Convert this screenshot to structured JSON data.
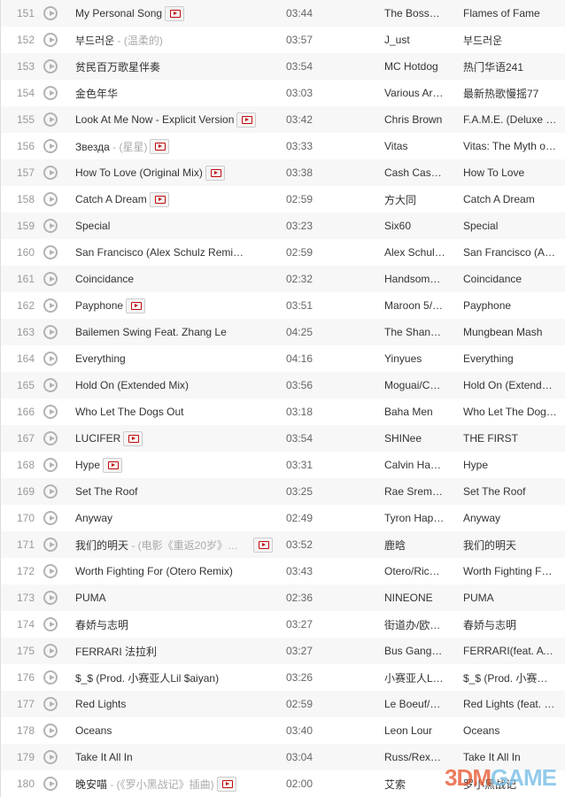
{
  "songs": [
    {
      "num": "151",
      "title": "My Personal Song",
      "sub": "",
      "mv": true,
      "duration": "03:44",
      "artist": "The Boss…",
      "album": "Flames of Fame"
    },
    {
      "num": "152",
      "title": "부드러운",
      "sub": " - (温柔的)",
      "mv": false,
      "duration": "03:57",
      "artist": "J_ust",
      "album": "부드러운"
    },
    {
      "num": "153",
      "title": "贫民百万歌星伴奏",
      "sub": "",
      "mv": false,
      "duration": "03:54",
      "artist": "MC Hotdog",
      "album": "热门华语241"
    },
    {
      "num": "154",
      "title": "金色年华",
      "sub": "",
      "mv": false,
      "duration": "03:03",
      "artist": "Various Ar…",
      "album": "最新热歌慢摇77"
    },
    {
      "num": "155",
      "title": "Look At Me Now - Explicit Version",
      "sub": "",
      "mv": true,
      "duration": "03:42",
      "artist": "Chris Brown",
      "album": "F.A.M.E. (Deluxe …"
    },
    {
      "num": "156",
      "title": "Звезда",
      "sub": " - (星星)",
      "mv": true,
      "duration": "03:33",
      "artist": "Vitas",
      "album": "Vitas: The Myth of…"
    },
    {
      "num": "157",
      "title": "How To Love (Original Mix)",
      "sub": "",
      "mv": true,
      "duration": "03:38",
      "artist": "Cash Cas…",
      "album": "How To Love"
    },
    {
      "num": "158",
      "title": "Catch A Dream",
      "sub": "",
      "mv": true,
      "duration": "02:59",
      "artist": "方大同",
      "album": "Catch A Dream"
    },
    {
      "num": "159",
      "title": "Special",
      "sub": "",
      "mv": false,
      "duration": "03:23",
      "artist": "Six60",
      "album": "Special"
    },
    {
      "num": "160",
      "title": "San Francisco (Alex Schulz Remi…",
      "sub": "",
      "mv": false,
      "duration": "02:59",
      "artist": "Alex Schul…",
      "album": "San Francisco (A…"
    },
    {
      "num": "161",
      "title": "Coincidance",
      "sub": "",
      "mv": false,
      "duration": "02:32",
      "artist": "Handsom…",
      "album": "Coincidance"
    },
    {
      "num": "162",
      "title": "Payphone",
      "sub": "",
      "mv": true,
      "duration": "03:51",
      "artist": "Maroon 5/…",
      "album": "Payphone"
    },
    {
      "num": "163",
      "title": "Bailemen Swing Feat. Zhang Le",
      "sub": "",
      "mv": false,
      "duration": "04:25",
      "artist": "The Shan…",
      "album": "Mungbean Mash"
    },
    {
      "num": "164",
      "title": "Everything",
      "sub": "",
      "mv": false,
      "duration": "04:16",
      "artist": "Yinyues",
      "album": "Everything"
    },
    {
      "num": "165",
      "title": "Hold On (Extended Mix)",
      "sub": "",
      "mv": false,
      "duration": "03:56",
      "artist": "Moguai/C…",
      "album": " Hold On (Extend…"
    },
    {
      "num": "166",
      "title": "Who Let The Dogs Out",
      "sub": "",
      "mv": false,
      "duration": "03:18",
      "artist": "Baha Men",
      "album": "Who Let The Dog…"
    },
    {
      "num": "167",
      "title": "LUCIFER",
      "sub": "",
      "mv": true,
      "duration": "03:54",
      "artist": "SHINee",
      "album": "THE FIRST"
    },
    {
      "num": "168",
      "title": "Hype",
      "sub": "",
      "mv": true,
      "duration": "03:31",
      "artist": "Calvin Ha…",
      "album": "Hype"
    },
    {
      "num": "169",
      "title": "Set The Roof",
      "sub": "",
      "mv": false,
      "duration": "03:25",
      "artist": "Rae Srem…",
      "album": "Set The Roof"
    },
    {
      "num": "170",
      "title": "Anyway",
      "sub": "",
      "mv": false,
      "duration": "02:49",
      "artist": "Tyron Hap…",
      "album": "Anyway"
    },
    {
      "num": "171",
      "title": "我们的明天",
      "sub": " - (电影《重返20岁》…",
      "mv": true,
      "mvFar": true,
      "duration": "03:52",
      "artist": "鹿晗",
      "album": "我们的明天"
    },
    {
      "num": "172",
      "title": "Worth Fighting For (Otero Remix)",
      "sub": "",
      "mv": false,
      "duration": "03:43",
      "artist": "Otero/Ric…",
      "album": "Worth Fighting F…"
    },
    {
      "num": "173",
      "title": "PUMA",
      "sub": "",
      "mv": false,
      "duration": "02:36",
      "artist": "NINEONE",
      "album": "PUMA"
    },
    {
      "num": "174",
      "title": "春娇与志明",
      "sub": "",
      "mv": false,
      "duration": "03:27",
      "artist": "街道办/欧…",
      "album": "春娇与志明"
    },
    {
      "num": "175",
      "title": "FERRARI 法拉利",
      "sub": "",
      "mv": false,
      "duration": "03:27",
      "artist": "Bus Gang…",
      "album": "FERRARI(feat. AT…"
    },
    {
      "num": "176",
      "title": "$_$ (Prod. 小赛亚人Lil $aiyan)",
      "sub": "",
      "mv": false,
      "duration": "03:26",
      "artist": "小赛亚人L…",
      "album": "$_$ (Prod. 小赛…"
    },
    {
      "num": "177",
      "title": "Red Lights",
      "sub": "",
      "mv": false,
      "duration": "02:59",
      "artist": "Le Boeuf/…",
      "album": "Red Lights (feat. …"
    },
    {
      "num": "178",
      "title": "Oceans",
      "sub": "",
      "mv": false,
      "duration": "03:40",
      "artist": "Leon Lour",
      "album": "Oceans"
    },
    {
      "num": "179",
      "title": "Take It All In",
      "sub": "",
      "mv": false,
      "duration": "03:04",
      "artist": "Russ/Rex…",
      "album": "Take It All In"
    },
    {
      "num": "180",
      "title": "晚安喵",
      "sub": " - (《罗小黑战记》插曲)",
      "mv": true,
      "duration": "02:00",
      "artist": "艾索",
      "album": "罗小黑战记"
    }
  ],
  "watermark": {
    "a": "3DM",
    "b": "GAME"
  },
  "colors": {
    "accent": "#c20c0c",
    "row_alt": "#f7f7f7"
  }
}
